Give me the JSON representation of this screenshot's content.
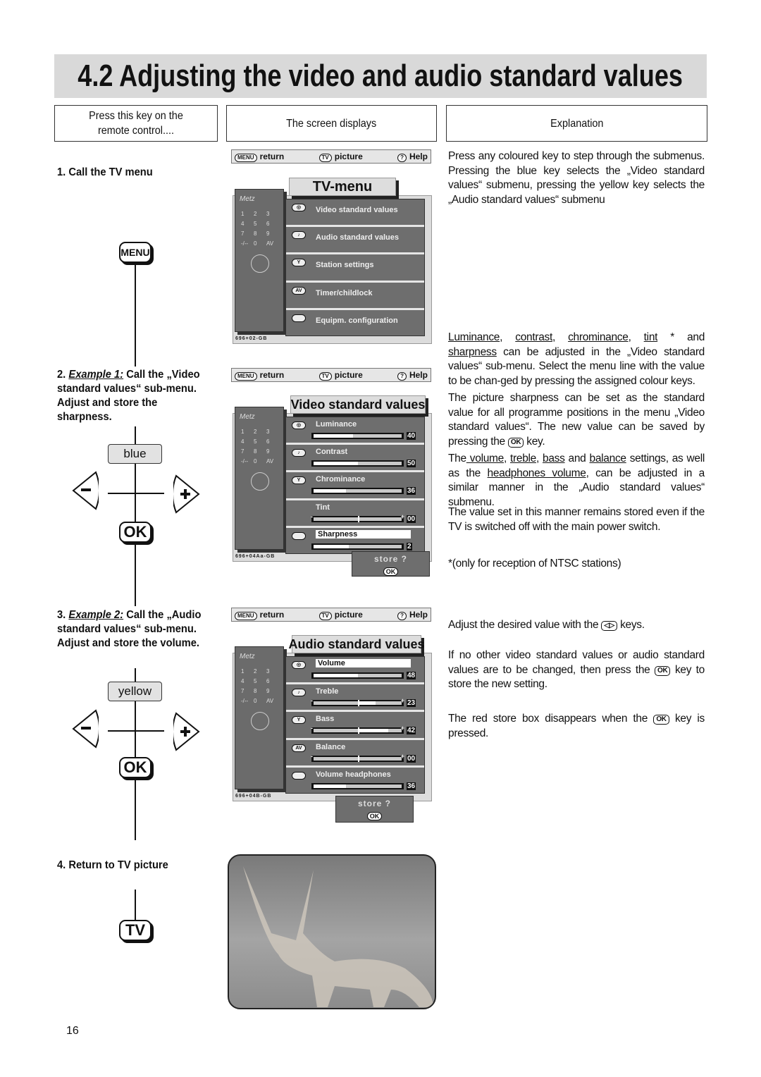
{
  "title": "4.2 Adjusting the video and audio standard values",
  "headers": {
    "col1": "Press this key on the remote control....",
    "col2": "The screen displays",
    "col3": "Explanation"
  },
  "steps": {
    "s1": "1. Call the TV menu",
    "s2_num": "2. ",
    "s2_ex": "Example 1:",
    "s2_text": " Call the „Video standard values“ sub-menu. Adjust and store the sharpness.",
    "s3_num": "3. ",
    "s3_ex": "Example 2:",
    "s3_text": " Call the „Audio standard values“ sub-menu. Adjust and store the volume.",
    "s4": "4. Return to TV picture"
  },
  "keys": {
    "menu": "MENU",
    "blue": "blue",
    "yellow": "yellow",
    "ok": "OK",
    "tv": "TV",
    "minus": "−",
    "plus": "+"
  },
  "nav": {
    "return_key": "MENU",
    "return": "return",
    "picture_key": "TV",
    "picture": "picture",
    "help_key": "?",
    "help": "Help"
  },
  "remote": {
    "brand": "Metz",
    "digits": [
      "1",
      "2",
      "3",
      "4",
      "5",
      "6",
      "7",
      "8",
      "9",
      "-/--",
      "0",
      "AV"
    ]
  },
  "screens": [
    {
      "title": "TV-menu",
      "code": "696+02-GB",
      "store": null,
      "rows": [
        {
          "icon": "video",
          "label": "Video standard values"
        },
        {
          "icon": "audio",
          "label": "Audio standard values"
        },
        {
          "icon": "station",
          "label": "Station settings"
        },
        {
          "icon": "AV",
          "label": "Timer/childlock"
        },
        {
          "icon": "blank",
          "label": "Equipm. configuration"
        }
      ]
    },
    {
      "title": "Video standard values",
      "code": "696+04Aa-GB",
      "store": {
        "label": "store ?",
        "key": "OK"
      },
      "rows": [
        {
          "icon": "video",
          "label": "Luminance",
          "value": "40",
          "level": 0.45
        },
        {
          "icon": "audio",
          "label": "Contrast",
          "value": "50",
          "level": 0.5
        },
        {
          "icon": "station",
          "label": "Chrominance",
          "value": "36",
          "level": 0.37
        },
        {
          "icon": "none",
          "label": "Tint",
          "value": "00",
          "centered": true,
          "level": 0
        },
        {
          "icon": "blank",
          "label": "Sharpness",
          "value": "2",
          "level": 0.4,
          "selected": true
        }
      ]
    },
    {
      "title": "Audio standard values",
      "code": "696+04B-GB",
      "store": {
        "label": "store ?",
        "key": "OK"
      },
      "rows": [
        {
          "icon": "video",
          "label": "Volume",
          "value": "48",
          "level": 0.5,
          "selected": true
        },
        {
          "icon": "audio",
          "label": "Treble",
          "value": "23",
          "centered": true,
          "level": 0.2
        },
        {
          "icon": "station",
          "label": "Bass",
          "value": "42",
          "centered": true,
          "level": 0.35
        },
        {
          "icon": "AV",
          "label": "Balance",
          "value": "00",
          "centered": true,
          "level": 0
        },
        {
          "icon": "blank",
          "label": "Volume headphones",
          "value": "36",
          "level": 0.37
        }
      ]
    }
  ],
  "explanation": [
    [
      {
        "t": "Press any coloured key to step through the submenus. Pressing the blue key selects the „Video standard values“ submenu, pressing the yellow key selects the „Audio standard values“ submenu"
      }
    ],
    [
      {
        "t": "Luminance",
        "u": 1
      },
      {
        "t": ", "
      },
      {
        "t": "contrast",
        "u": 1
      },
      {
        "t": ", "
      },
      {
        "t": "chrominance",
        "u": 1
      },
      {
        "t": ", "
      },
      {
        "t": "tint",
        "u": 1
      },
      {
        "t": " * and "
      },
      {
        "t": "sharpness",
        "u": 1
      },
      {
        "t": " can be adjusted in the „Video standard values“ sub-menu. Select the menu line with the value to be chan-ged by pressing the assigned colour keys."
      }
    ],
    [
      {
        "t": "The picture sharpness can be set as the standard value for all programme positions in the menu „Video standard values“. The new value can be saved by pressing the "
      },
      {
        "k": "OK"
      },
      {
        "t": " key."
      }
    ],
    [
      {
        "t": "The"
      },
      {
        "t": " volume",
        "u": 1
      },
      {
        "t": ", "
      },
      {
        "t": "treble",
        "u": 1
      },
      {
        "t": ", "
      },
      {
        "t": "bass",
        "u": 1
      },
      {
        "t": " and "
      },
      {
        "t": "balance",
        "u": 1
      },
      {
        "t": " settings, as well as the "
      },
      {
        "t": "headphones volume",
        "u": 1
      },
      {
        "t": ", can be adjusted in a similar manner in the „Audio standard values“ submenu."
      }
    ],
    [
      {
        "t": "The value set in this manner remains stored even if the TV is switched off with the main power switch."
      }
    ],
    [
      {
        "t": "*(only for reception of NTSC stations)"
      }
    ],
    [
      {
        "t": "Adjust the desired value with the "
      },
      {
        "k": "◁▷"
      },
      {
        "t": " keys."
      }
    ],
    [
      {
        "t": "If no other video standard values or audio standard values are to be changed, then press the "
      },
      {
        "k": "OK"
      },
      {
        "t": " key to store the new setting."
      }
    ],
    [
      {
        "t": "The red store box disappears when the "
      },
      {
        "k": "OK"
      },
      {
        "t": " key is pressed."
      }
    ]
  ],
  "page_number": "16"
}
